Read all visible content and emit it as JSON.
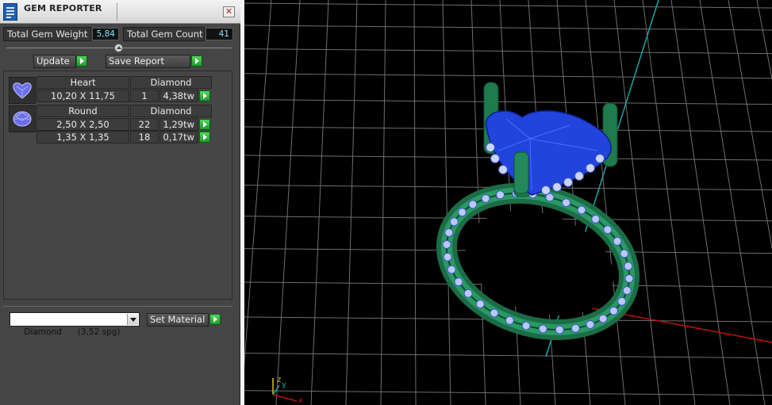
{
  "window": {
    "title": "GEM REPORTER",
    "close_glyph": "✕"
  },
  "summary": {
    "weight_label": "Total Gem Weight",
    "weight_value": "5,84",
    "count_label": "Total Gem Count",
    "count_value": "41"
  },
  "toolbar": {
    "update_label": "Update",
    "save_label": "Save Report"
  },
  "gems": [
    {
      "shape": "Heart",
      "material": "Diamond",
      "icon": "heart-gem-icon",
      "rows": [
        {
          "size": "10,20 X 11,75",
          "count": "1",
          "weight": "4,38tw"
        }
      ]
    },
    {
      "shape": "Round",
      "material": "Diamond",
      "icon": "round-gem-icon",
      "rows": [
        {
          "size": "2,50 X 2,50",
          "count": "22",
          "weight": "1,29tw"
        },
        {
          "size": "1,35 X 1,35",
          "count": "18",
          "weight": "0,17tw"
        }
      ]
    }
  ],
  "material": {
    "selected": "Diamond      (3,52 spg)",
    "set_label": "Set Material"
  },
  "viewport": {
    "axis_labels": {
      "z": "z",
      "y": "y",
      "x": "x"
    },
    "colors": {
      "background": "#000000",
      "grid": "#6e6e6e",
      "metal": "#1f7a4e",
      "gem": "#2244dd",
      "y_axis": "#1aa6a6",
      "x_axis": "#c01010"
    }
  },
  "colors": {
    "panel_bg": "#454545",
    "value_text": "#7fe6ff",
    "go_button": "#2fb23e"
  }
}
